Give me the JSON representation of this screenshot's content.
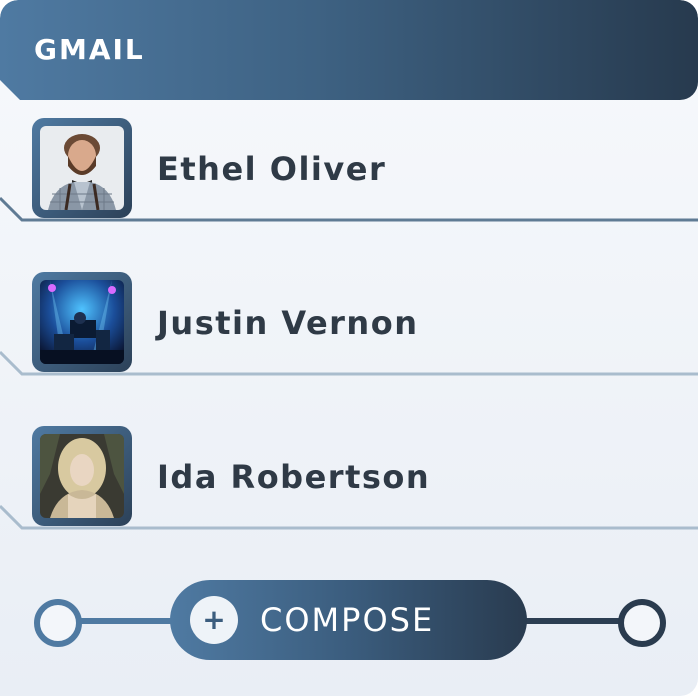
{
  "header": {
    "title": "GMAIL"
  },
  "contacts": [
    {
      "name": "Ethel Oliver",
      "avatar": "bearded-man-photo"
    },
    {
      "name": "Justin Vernon",
      "avatar": "concert-stage-photo"
    },
    {
      "name": "Ida Robertson",
      "avatar": "blonde-woman-photo"
    }
  ],
  "compose": {
    "label": "COMPOSE",
    "icon": "plus-icon",
    "icon_glyph": "+"
  },
  "colors": {
    "accent_light": "#4f7aa2",
    "accent_dark": "#273a4e",
    "text": "#2f3a46"
  }
}
